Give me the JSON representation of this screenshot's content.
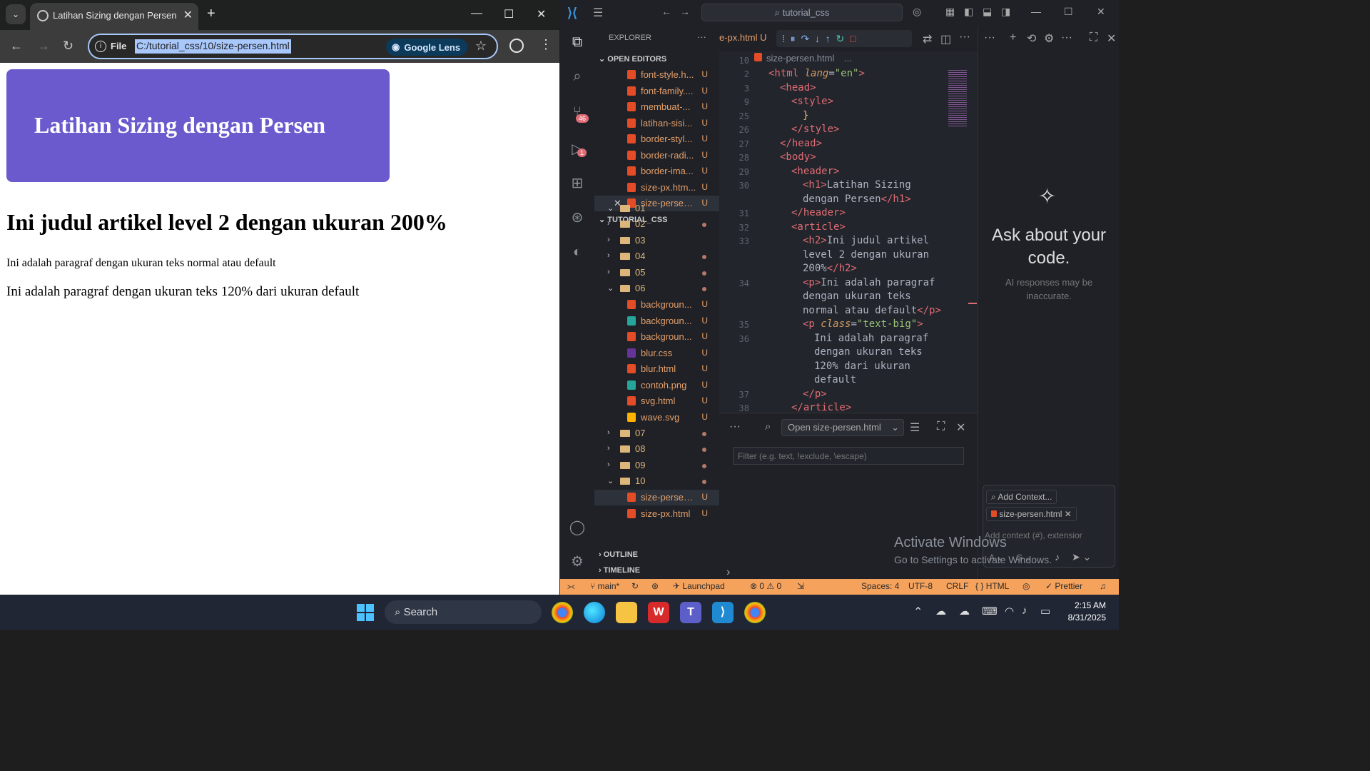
{
  "chrome": {
    "tab_title": "Latihan Sizing dengan Persen",
    "file_label": "File",
    "url": "C:/tutorial_css/10/size-persen.html",
    "lens_label": "Google Lens"
  },
  "page": {
    "header_title": "Latihan Sizing dengan Persen",
    "h2": "Ini judul artikel level 2 dengan ukuran 200%",
    "p1": "Ini adalah paragraf dengan ukuran teks normal atau default",
    "p2": "Ini adalah paragraf dengan ukuran teks 120% dari ukuran default",
    "header_color": "#6a5acd"
  },
  "vscode": {
    "search": "tutorial_css",
    "explorer_title": "EXPLORER",
    "open_editors_label": "OPEN EDITORS",
    "workspace_label": "TUTORIAL_CSS",
    "outline_label": "OUTLINE",
    "timeline_label": "TIMELINE",
    "source_control_badge": "46",
    "run_badge": "1",
    "open_editors": [
      {
        "name": "font-style.h...",
        "status": "U"
      },
      {
        "name": "font-family....",
        "status": "U"
      },
      {
        "name": "membuat-...",
        "status": "U"
      },
      {
        "name": "latihan-sisi...",
        "status": "U"
      },
      {
        "name": "border-styl...",
        "status": "U"
      },
      {
        "name": "border-radi...",
        "status": "U"
      },
      {
        "name": "border-ima...",
        "status": "U"
      },
      {
        "name": "size-px.htm...",
        "status": "U"
      },
      {
        "name": "size-persen...",
        "status": "U"
      }
    ],
    "tree": {
      "f01": "01",
      "f02": "02",
      "f03": "03",
      "f04": "04",
      "f05": "05",
      "f06": "06",
      "files06": [
        {
          "name": "backgroun...",
          "status": "U"
        },
        {
          "name": "backgroun...",
          "status": "U"
        },
        {
          "name": "backgroun...",
          "status": "U"
        },
        {
          "name": "blur.css",
          "status": "U"
        },
        {
          "name": "blur.html",
          "status": "U"
        },
        {
          "name": "contoh.png",
          "status": "U"
        },
        {
          "name": "svg.html",
          "status": "U"
        },
        {
          "name": "wave.svg",
          "status": "U"
        }
      ],
      "f07": "07",
      "f08": "08",
      "f09": "09",
      "f10": "10",
      "files10": [
        {
          "name": "size-persen...",
          "status": "U"
        },
        {
          "name": "size-px.html",
          "status": "U"
        }
      ]
    },
    "editor_tab": "e-px.html",
    "editor_tab_status": "U",
    "breadcrumb_file": "size-persen.html",
    "breadcrumb_more": "...",
    "line_numbers": [
      "10",
      "2",
      "3",
      "9",
      "25",
      "26",
      "27",
      "28",
      "29",
      "30",
      "31",
      "32",
      "33",
      "34",
      "35",
      "36",
      "37",
      "38"
    ],
    "panel": {
      "filter_select": "Open size-persen.html",
      "filter_placeholder": "Filter (e.g. text, !exclude, \\escape)"
    },
    "chat": {
      "heading": "Ask about your code.",
      "note": "AI responses may be inaccurate.",
      "add_context": "Add Context...",
      "context_file": "size-persen.html",
      "input_placeholder": "Add context (#), extensior",
      "watermark_title": "Activate Windows",
      "watermark_sub": "Go to Settings to activate Windows."
    },
    "status": {
      "branch": "main*",
      "launchpad": "Launchpad",
      "errors": "0",
      "warnings": "0",
      "spaces": "Spaces: 4",
      "encoding": "UTF-8",
      "eol": "CRLF",
      "language": "HTML",
      "prettier": "Prettier"
    }
  },
  "taskbar": {
    "search_label": "Search",
    "time": "2:15 AM",
    "date": "8/31/2025"
  }
}
